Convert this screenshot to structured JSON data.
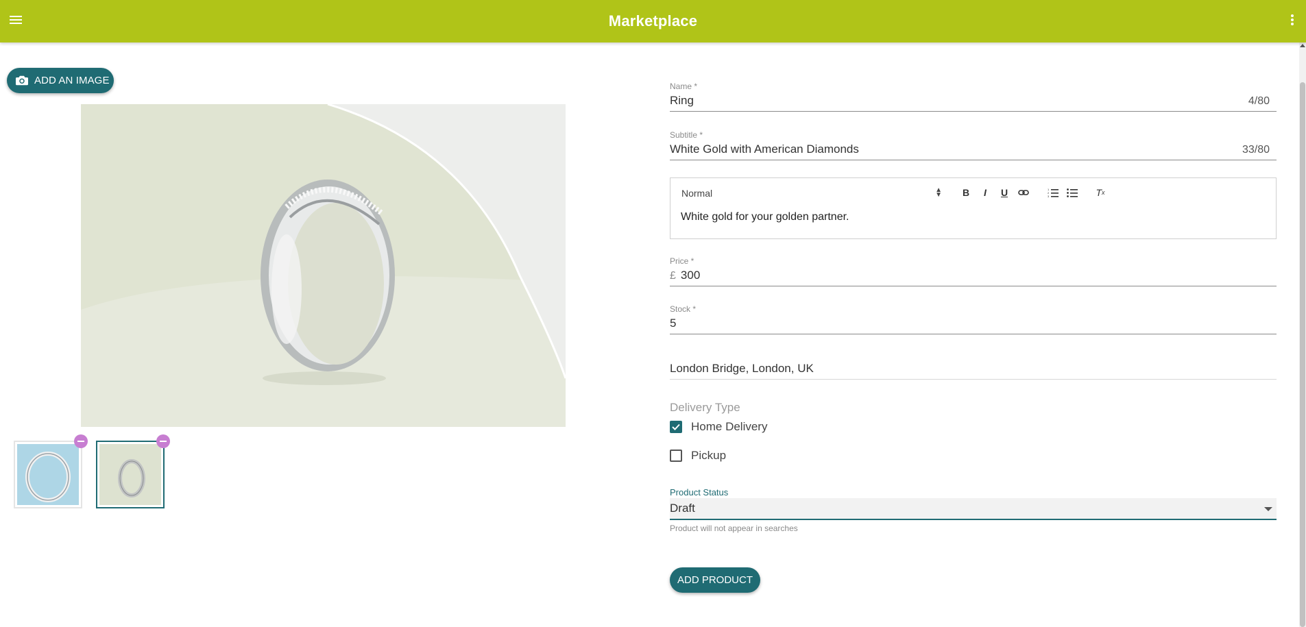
{
  "appbar": {
    "title": "Marketplace"
  },
  "images": {
    "add_label": "ADD AN IMAGE",
    "thumbnails": [
      {
        "alt": "ring on blue background"
      },
      {
        "alt": "ring on pale green background"
      }
    ]
  },
  "form": {
    "name": {
      "label": "Name *",
      "value": "Ring",
      "counter": "4/80"
    },
    "subtitle": {
      "label": "Subtitle *",
      "value": "White Gold with American Diamonds",
      "counter": "33/80"
    },
    "editor": {
      "format": "Normal",
      "content": "White gold for your golden partner."
    },
    "price": {
      "label": "Price *",
      "prefix": "£",
      "value": "300"
    },
    "stock": {
      "label": "Stock *",
      "value": "5"
    },
    "location": {
      "value": "London Bridge, London, UK"
    },
    "delivery": {
      "title": "Delivery Type",
      "options": [
        {
          "label": "Home Delivery",
          "checked": true
        },
        {
          "label": "Pickup",
          "checked": false
        }
      ]
    },
    "status": {
      "label": "Product Status",
      "value": "Draft",
      "help": "Product will not appear in searches"
    },
    "submit_label": "ADD PRODUCT"
  },
  "colors": {
    "appbar": "#b0c418",
    "primary": "#1f6b73",
    "remove": "#c77ed1"
  }
}
